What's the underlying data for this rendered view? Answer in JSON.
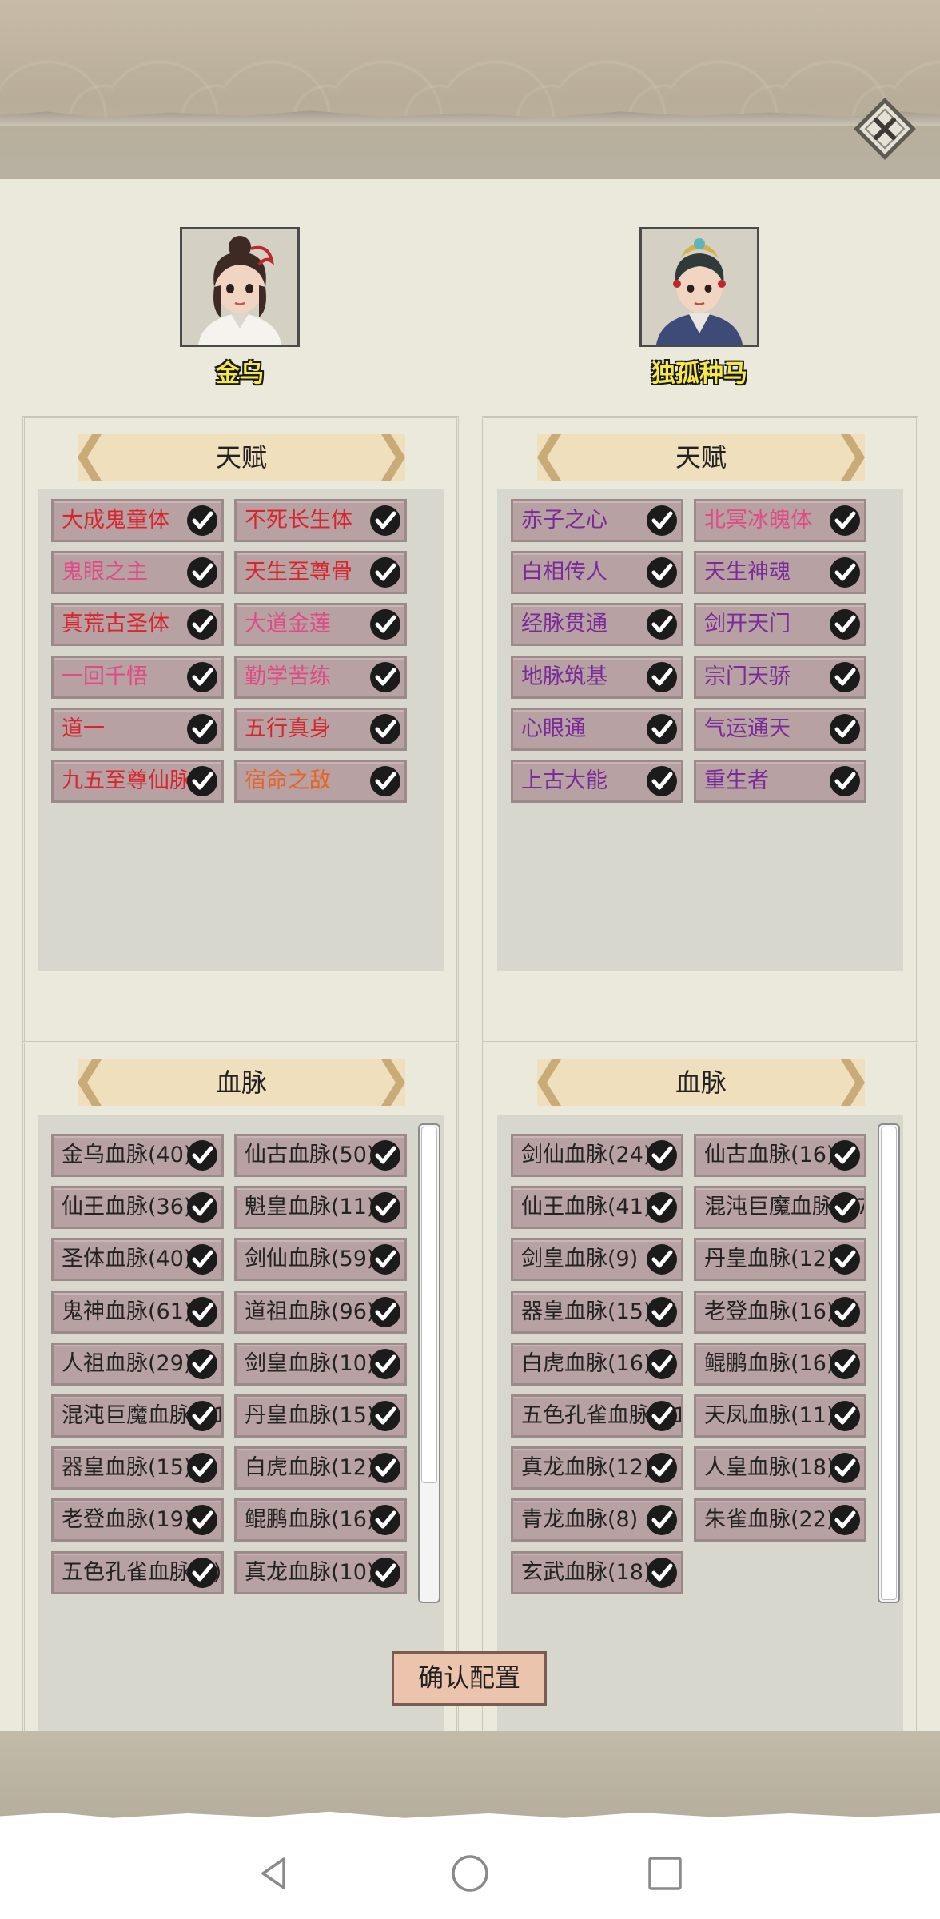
{
  "characters": [
    {
      "name": "金乌"
    },
    {
      "name": "独孤种马"
    }
  ],
  "talent_title": "天赋",
  "bloodline_title": "血脉",
  "left": {
    "talents": [
      {
        "label": "大成鬼童体",
        "color": "#d8252d"
      },
      {
        "label": "不死长生体",
        "color": "#d8252d"
      },
      {
        "label": "鬼眼之主",
        "color": "#e04a86"
      },
      {
        "label": "天生至尊骨",
        "color": "#d8252d"
      },
      {
        "label": "真荒古圣体",
        "color": "#d8252d"
      },
      {
        "label": "大道金莲",
        "color": "#e04a86"
      },
      {
        "label": "一回千悟",
        "color": "#e04a86"
      },
      {
        "label": "勤学苦练",
        "color": "#e04a86"
      },
      {
        "label": "道一",
        "color": "#d8252d"
      },
      {
        "label": "五行真身",
        "color": "#d8252d"
      },
      {
        "label": "九五至尊仙脉",
        "color": "#d8252d"
      },
      {
        "label": "宿命之敌",
        "color": "#e8632a"
      }
    ],
    "bloodlines": [
      "金乌血脉(40)",
      "仙古血脉(50)",
      "仙王血脉(36)",
      "魁皇血脉(11)",
      "圣体血脉(40)",
      "剑仙血脉(59)",
      "鬼神血脉(61)",
      "道祖血脉(96)",
      "人祖血脉(29)",
      "剑皇血脉(10)",
      "混沌巨魔血脉(21)",
      "丹皇血脉(15)",
      "器皇血脉(15)",
      "白虎血脉(12)",
      "老登血脉(19)",
      "鲲鹏血脉(16)",
      "五色孔雀血脉(8)",
      "真龙血脉(10)"
    ]
  },
  "right": {
    "talents": [
      {
        "label": "赤子之心",
        "color": "#7a2a9a"
      },
      {
        "label": "北冥冰魄体",
        "color": "#e04a86"
      },
      {
        "label": "白相传人",
        "color": "#7a2a9a"
      },
      {
        "label": "天生神魂",
        "color": "#7a2a9a"
      },
      {
        "label": "经脉贯通",
        "color": "#7a2a9a"
      },
      {
        "label": "剑开天门",
        "color": "#7a2a9a"
      },
      {
        "label": "地脉筑基",
        "color": "#7a2a9a"
      },
      {
        "label": "宗门天骄",
        "color": "#7a2a9a"
      },
      {
        "label": "心眼通",
        "color": "#7a2a9a"
      },
      {
        "label": "气运通天",
        "color": "#7a2a9a"
      },
      {
        "label": "上古大能",
        "color": "#7a2a9a"
      },
      {
        "label": "重生者",
        "color": "#7a2a9a"
      }
    ],
    "bloodlines": [
      "剑仙血脉(24)",
      "仙古血脉(16)",
      "仙王血脉(41)",
      "混沌巨魔血脉(27)",
      "剑皇血脉(9)",
      "丹皇血脉(12)",
      "器皇血脉(15)",
      "老登血脉(16)",
      "白虎血脉(16)",
      "鲲鹏血脉(16)",
      "五色孔雀血脉(21)",
      "天凤血脉(11)",
      "真龙血脉(12)",
      "人皇血脉(18)",
      "青龙血脉(8)",
      "朱雀血脉(22)",
      "玄武血脉(18)"
    ]
  },
  "confirm_label": "确认配置"
}
